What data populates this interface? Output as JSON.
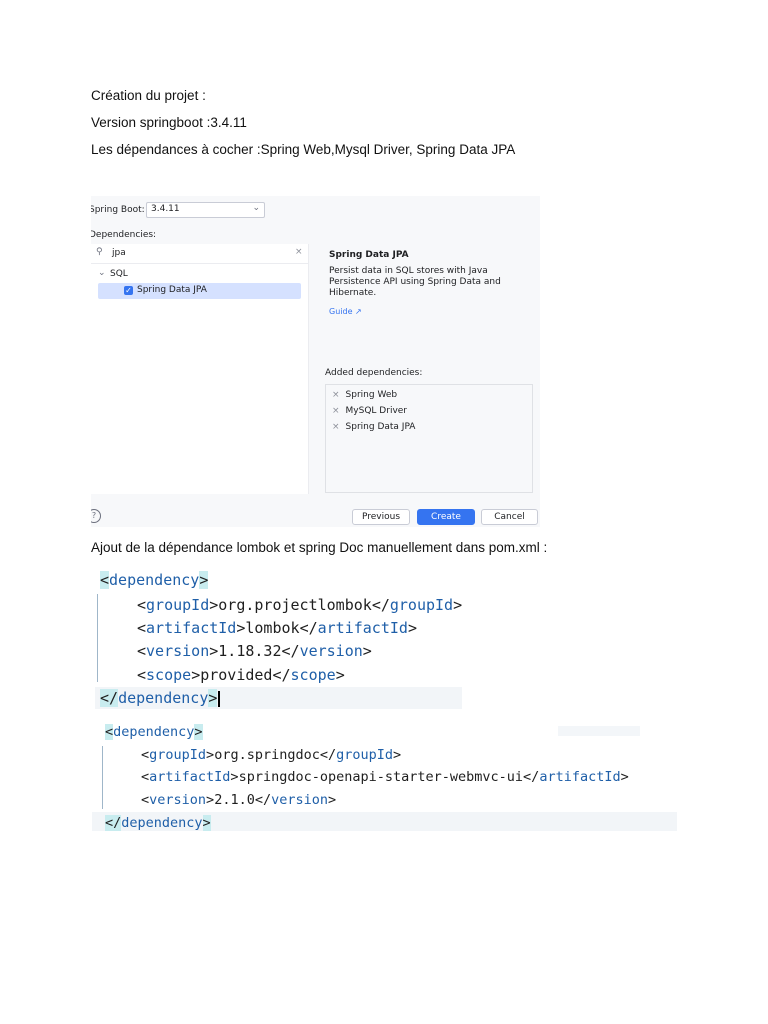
{
  "intro": {
    "line1": "Création du projet :",
    "line2": "Version springboot :3.4.11",
    "line3": "Les dépendances à cocher :Spring Web,Mysql Driver, Spring Data JPA",
    "line4": "Ajout de la dépendance lombok et spring Doc manuellement dans pom.xml :"
  },
  "dialog": {
    "spring_boot_label": "Spring Boot:",
    "spring_boot_value": "3.4.11",
    "dependencies_label": "Dependencies:",
    "search_value": "jpa",
    "group_label": "SQL",
    "item_label": "Spring Data JPA",
    "detail_title": "Spring Data JPA",
    "detail_desc_1": "Persist data in SQL stores with Java",
    "detail_desc_2": "Persistence API using Spring Data and",
    "detail_desc_3": "Hibernate.",
    "guide_label": "Guide ↗",
    "added_label": "Added dependencies:",
    "added": [
      "Spring Web",
      "MySQL Driver",
      "Spring Data JPA"
    ],
    "previous": "Previous",
    "create": "Create",
    "cancel": "Cancel",
    "help": "?"
  },
  "code1": {
    "open": "<dependency>",
    "close": "</dependency>",
    "lines": [
      {
        "t1": "groupId",
        "v": "org.projectlombok"
      },
      {
        "t1": "artifactId",
        "v": "lombok"
      },
      {
        "t1": "version",
        "v": "1.18.32"
      },
      {
        "t1": "scope",
        "v": "provided"
      }
    ]
  },
  "code2": {
    "open": "<dependency>",
    "close": "</dependency>",
    "lines": [
      {
        "t1": "groupId",
        "v": "org.springdoc"
      },
      {
        "t1": "artifactId",
        "v": "springdoc-openapi-starter-webmvc-ui"
      },
      {
        "t1": "version",
        "v": "2.1.0"
      }
    ]
  },
  "colors": {
    "accent": "#3574f0",
    "tag": "#1f5fa8",
    "highlight": "#c8ecef"
  }
}
